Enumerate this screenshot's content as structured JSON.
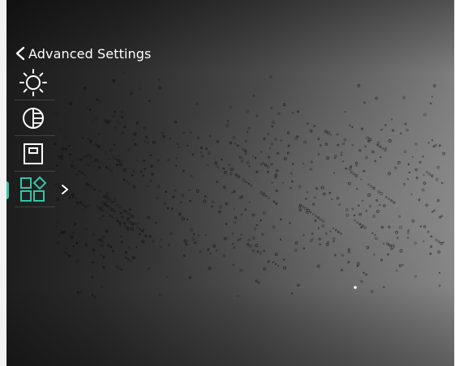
{
  "header": {
    "back_label": "Advanced Settings"
  },
  "menu": {
    "items": [
      {
        "id": "brightness",
        "icon": "brightness-icon",
        "active": false
      },
      {
        "id": "contrast",
        "icon": "contrast-icon",
        "active": false
      },
      {
        "id": "frame",
        "icon": "frame-icon",
        "active": false
      },
      {
        "id": "function-settings",
        "icon": "function-grid-icon",
        "active": true
      }
    ]
  },
  "colors": {
    "accent": "#35c4a8",
    "icon": "#ffffff"
  }
}
